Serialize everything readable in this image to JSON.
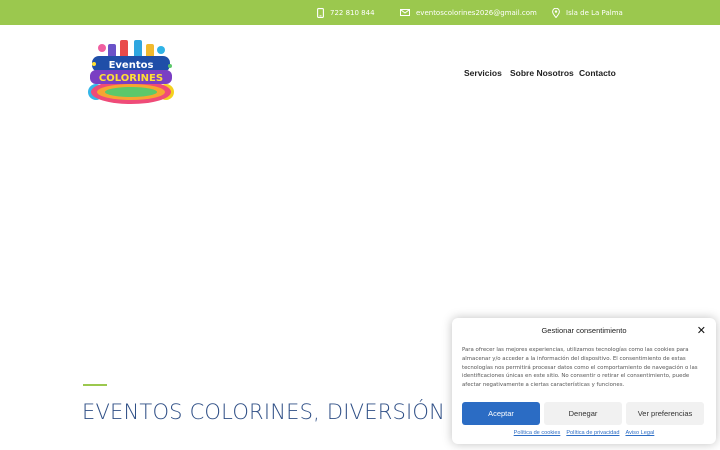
{
  "topbar": {
    "phone": "722 810 844",
    "email": "eventoscolorines2026@gmail.com",
    "location": "Isla de La Palma",
    "bg_color": "#9bc84e"
  },
  "logo": {
    "line1": "Eventos",
    "line2": "COLORINES"
  },
  "nav": {
    "items": [
      "Servicios",
      "Sobre Nosotros",
      "Contacto"
    ]
  },
  "hero": {
    "title": "EVENTOS COLORINES, DIVERSIÓN PARA LOS PEQUEÑOS",
    "title_color": "#2f4f86"
  },
  "cookie": {
    "title": "Gestionar consentimiento",
    "text": "Para ofrecer las mejores experiencias, utilizamos tecnologías como las cookies para almacenar y/o acceder a la información del dispositivo. El consentimiento de estas tecnologías nos permitirá procesar datos como el comportamiento de navegación o las identificaciones únicas en este sitio. No consentir o retirar el consentimiento, puede afectar negativamente a ciertas características y funciones.",
    "accept": "Aceptar",
    "deny": "Denegar",
    "prefs": "Ver preferencias",
    "links": [
      "Política de cookies",
      "Política de privacidad",
      "Aviso Legal"
    ],
    "accent_color": "#2b6cc4"
  }
}
